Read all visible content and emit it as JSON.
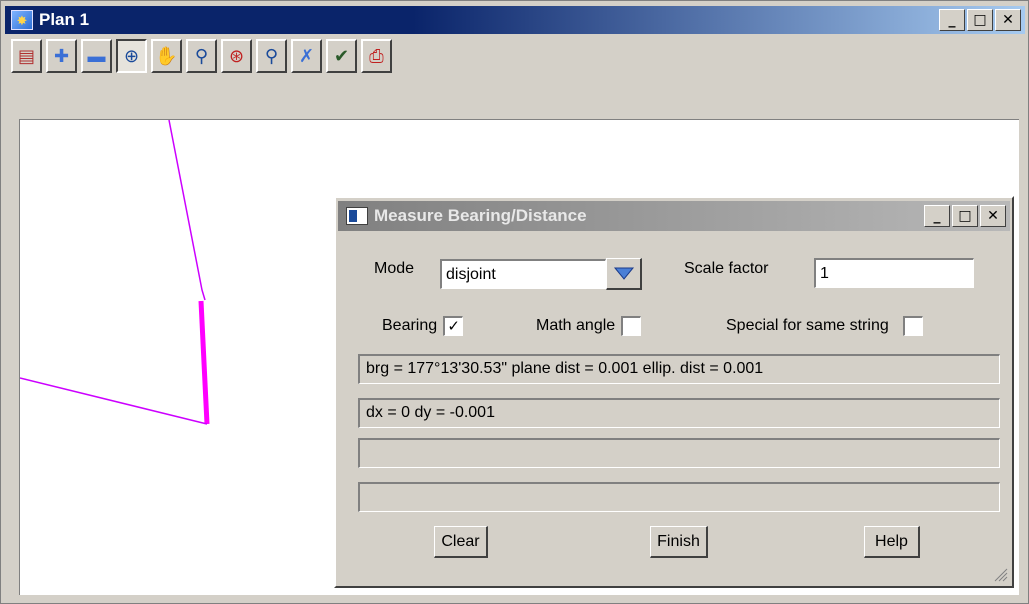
{
  "plan_window": {
    "title": "Plan 1",
    "minimize": "_",
    "maximize": "□",
    "close": "✕"
  },
  "toolbar": {
    "buttons": [
      {
        "name": "plot-icon",
        "glyph": "▤",
        "color": "#b03030"
      },
      {
        "name": "zoom-in-plus-icon",
        "glyph": "✚",
        "color": "#3a6fd6"
      },
      {
        "name": "zoom-out-minus-icon",
        "glyph": "▬",
        "color": "#3a6fd6"
      },
      {
        "name": "zoom-window-icon",
        "glyph": "⊕",
        "color": "#1a4a9a"
      },
      {
        "name": "pan-icon",
        "glyph": "✋",
        "color": "#b03060"
      },
      {
        "name": "zoom-in-icon",
        "glyph": "⚲",
        "color": "#1a4a9a"
      },
      {
        "name": "zoom-extent-icon",
        "glyph": "⊛",
        "color": "#c02020"
      },
      {
        "name": "zoom-out-icon",
        "glyph": "⚲",
        "color": "#1a4a9a"
      },
      {
        "name": "cursor-cross-icon",
        "glyph": "✗",
        "color": "#3a6fd6"
      },
      {
        "name": "pick-icon",
        "glyph": "✔",
        "color": "#2a5a2a"
      },
      {
        "name": "print-icon",
        "glyph": "⎙",
        "color": "#c02020"
      }
    ],
    "active_index": 3
  },
  "dialog": {
    "title": "Measure Bearing/Distance",
    "minimize": "_",
    "maximize": "□",
    "close": "✕",
    "mode_label": "Mode",
    "mode_value": "disjoint",
    "scale_label": "Scale factor",
    "scale_value": "1",
    "bearing_label": "Bearing",
    "bearing_checked": "✓",
    "math_label": "Math angle",
    "math_checked": "",
    "special_label": "Special for same string",
    "special_checked": "",
    "output_lines": [
      "brg = 177°13'30.53\" plane dist = 0.001  ellip. dist = 0.001",
      "dx = 0 dy = -0.001",
      "",
      ""
    ],
    "clear_label": "Clear",
    "finish_label": "Finish",
    "help_label": "Help"
  },
  "colors": {
    "line_color": "#cc00ff",
    "selected_line_color": "#ff00ff",
    "title_active": "#0a246a",
    "title_inactive": "#808080"
  }
}
